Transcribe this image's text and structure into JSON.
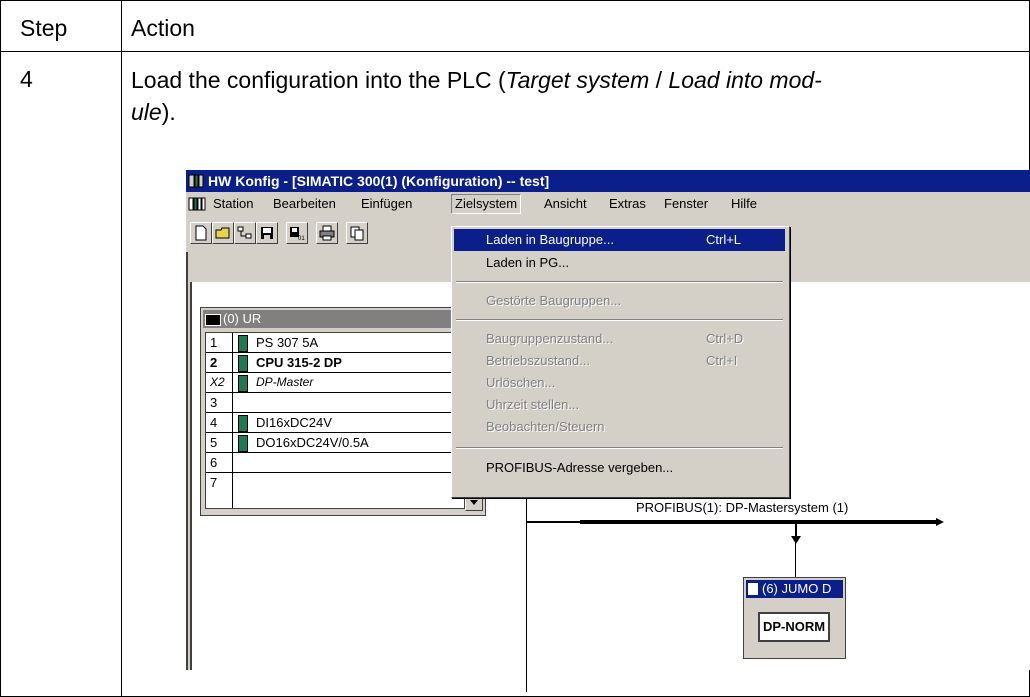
{
  "table": {
    "header_step": "Step",
    "header_action": "Action",
    "row_step": "4",
    "instruction_lead": "Load the configuration into the PLC (",
    "instruction_menu1": "Target system",
    "instruction_sep": " / ",
    "instruction_menu2_part1": "Load into mod-",
    "instruction_menu2_part2": "ule",
    "instruction_tail": ")."
  },
  "window": {
    "title": "HW Konfig - [SIMATIC 300(1) (Konfiguration) -- test]"
  },
  "menubar": {
    "items": [
      "Station",
      "Bearbeiten",
      "Einfügen",
      "Zielsystem",
      "Ansicht",
      "Extras",
      "Fenster",
      "Hilfe"
    ],
    "active": "Zielsystem"
  },
  "dropdown": {
    "items": [
      {
        "label": "Laden in Baugruppe...",
        "shortcut": "Ctrl+L",
        "state": "highlighted"
      },
      {
        "label": "Laden in PG...",
        "shortcut": "",
        "state": "enabled"
      },
      {
        "label": "Gestörte Baugruppen...",
        "shortcut": "",
        "state": "disabled"
      },
      {
        "label": "Baugruppenzustand...",
        "shortcut": "Ctrl+D",
        "state": "disabled"
      },
      {
        "label": "Betriebszustand...",
        "shortcut": "Ctrl+I",
        "state": "disabled"
      },
      {
        "label": "Urlöschen...",
        "shortcut": "",
        "state": "disabled"
      },
      {
        "label": "Uhrzeit stellen...",
        "shortcut": "",
        "state": "disabled"
      },
      {
        "label": "Beobachten/Steuern",
        "shortcut": "",
        "state": "disabled"
      },
      {
        "label": "PROFIBUS-Adresse vergeben...",
        "shortcut": "",
        "state": "enabled"
      }
    ]
  },
  "rack": {
    "title": "(0) UR",
    "rows": [
      {
        "slot": "1",
        "module": "PS 307 5A",
        "style": "normal"
      },
      {
        "slot": "2",
        "module": "CPU 315-2 DP",
        "style": "bold"
      },
      {
        "slot": "X2",
        "module": "DP-Master",
        "style": "italic"
      },
      {
        "slot": "3",
        "module": "",
        "style": "normal"
      },
      {
        "slot": "4",
        "module": "DI16xDC24V",
        "style": "normal"
      },
      {
        "slot": "5",
        "module": "DO16xDC24V/0.5A",
        "style": "normal"
      },
      {
        "slot": "6",
        "module": "",
        "style": "normal"
      },
      {
        "slot": "7",
        "module": "",
        "style": "normal"
      }
    ]
  },
  "profibus": {
    "label": "PROFIBUS(1): DP-Mastersystem (1)"
  },
  "slave": {
    "title": "(6) JUMO D",
    "button": "DP-NORM"
  }
}
